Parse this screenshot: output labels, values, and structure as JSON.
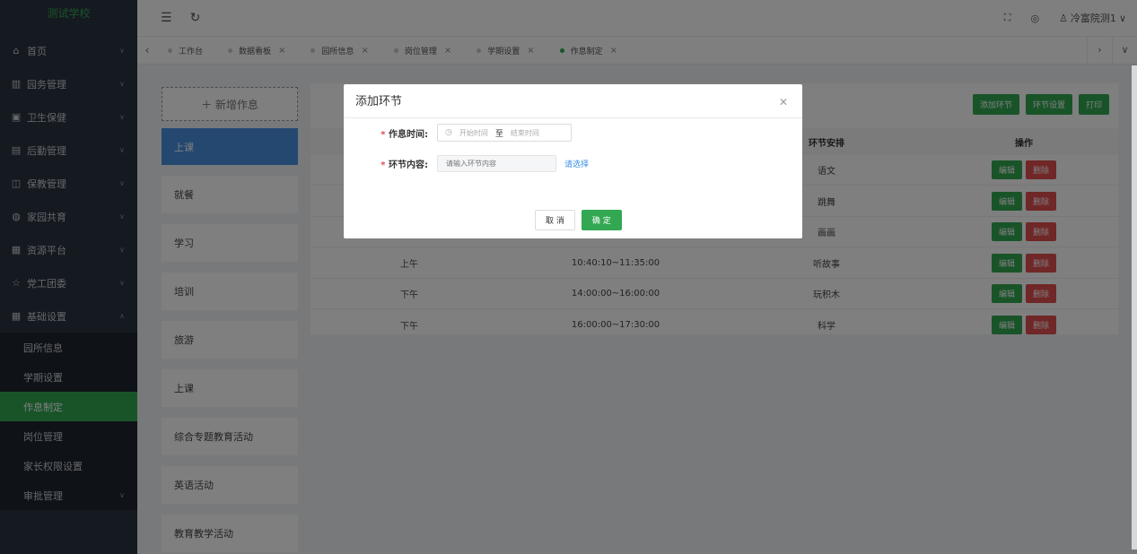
{
  "sidebar": {
    "logo": "测试学校",
    "menu": [
      {
        "icon": "home-icon",
        "glyph": "⌂",
        "label": "首页"
      },
      {
        "icon": "building-icon",
        "glyph": "▥",
        "label": "园务管理"
      },
      {
        "icon": "health-icon",
        "glyph": "▣",
        "label": "卫生保健"
      },
      {
        "icon": "logistics-icon",
        "glyph": "▤",
        "label": "后勤管理"
      },
      {
        "icon": "education-icon",
        "glyph": "◫",
        "label": "保教管理"
      },
      {
        "icon": "family-icon",
        "glyph": "◍",
        "label": "家园共育"
      },
      {
        "icon": "resource-icon",
        "glyph": "▦",
        "label": "资源平台"
      },
      {
        "icon": "star-icon",
        "glyph": "☆",
        "label": "党工团委"
      },
      {
        "icon": "grid-icon",
        "glyph": "▦",
        "label": "基础设置"
      }
    ],
    "submenu": [
      "园所信息",
      "学期设置",
      "作息制定",
      "岗位管理",
      "家长权限设置",
      "审批管理"
    ]
  },
  "header": {
    "user": "冷富院测1"
  },
  "tabs": [
    {
      "label": "工作台",
      "closable": false
    },
    {
      "label": "数据看板",
      "closable": true
    },
    {
      "label": "园所信息",
      "closable": true
    },
    {
      "label": "岗位管理",
      "closable": true
    },
    {
      "label": "学期设置",
      "closable": true
    },
    {
      "label": "作息制定",
      "closable": true
    }
  ],
  "left": {
    "add": "＋ 新增作息",
    "cards": [
      "上课",
      "就餐",
      "学习",
      "培训",
      "旅游",
      "上课",
      "综合专题教育活动",
      "英语活动",
      "教育教学活动"
    ]
  },
  "main": {
    "buttons": [
      "添加环节",
      "环节设置",
      "打印"
    ],
    "columns": [
      "",
      "",
      "环节安排",
      "操作"
    ],
    "rows": [
      {
        "period": "",
        "time": "",
        "item": "语文"
      },
      {
        "period": "",
        "time": "",
        "item": "跳舞"
      },
      {
        "period": "",
        "time": "",
        "item": "画画"
      },
      {
        "period": "上午",
        "time": "10:40:10~11:35:00",
        "item": "听故事"
      },
      {
        "period": "下午",
        "time": "14:00:00~16:00:00",
        "item": "玩积木"
      },
      {
        "period": "下午",
        "time": "16:00:00~17:30:00",
        "item": "科学"
      }
    ],
    "edit": "编辑",
    "delete": "删除"
  },
  "dialog": {
    "title": "添加环节",
    "time_label": "作息时间:",
    "start_placeholder": "开始时间",
    "to": "至",
    "end_placeholder": "结束时间",
    "content_label": "环节内容:",
    "content_placeholder": "请输入环节内容",
    "choose": "请选择",
    "cancel": "取 消",
    "ok": "确 定"
  }
}
